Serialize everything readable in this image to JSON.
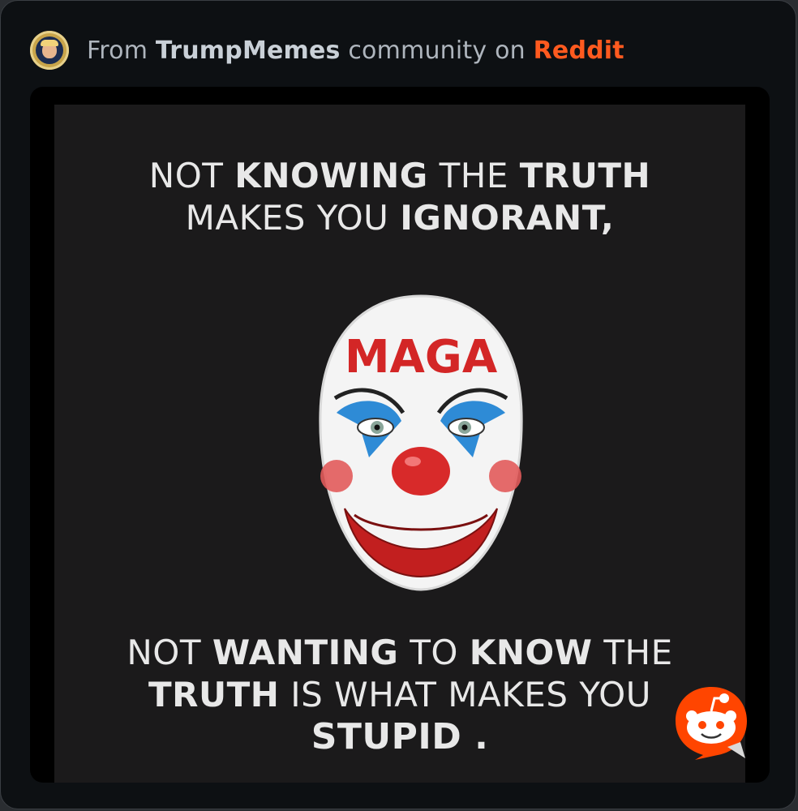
{
  "header": {
    "prefix": "From",
    "community": "TrumpMemes",
    "middle": "community on",
    "brand": "Reddit",
    "avatar_icon": "presidential-seal-avatar"
  },
  "meme": {
    "top_line1_a": "NOT",
    "top_line1_b": "KNOWING",
    "top_line1_c": "THE",
    "top_line1_d": "TRUTH",
    "top_line2_a": "MAKES YOU",
    "top_line2_b": "IGNORANT,",
    "mask_text": "MAGA",
    "bottom_line1_a": "NOT",
    "bottom_line1_b": "WANTING",
    "bottom_line1_c": "TO",
    "bottom_line1_d": "KNOW",
    "bottom_line1_e": "THE",
    "bottom_line2_a": "TRUTH",
    "bottom_line2_b": "IS WHAT MAKES YOU",
    "bottom_line3": "STUPID ."
  },
  "colors": {
    "brand": "#ff5a1f",
    "card_bg": "#0d1013",
    "meme_bg": "#1b1a1b",
    "mask_red": "#d32626",
    "mask_blue": "#2e8bd6"
  },
  "icons": {
    "reddit": "reddit-snoo-icon"
  }
}
